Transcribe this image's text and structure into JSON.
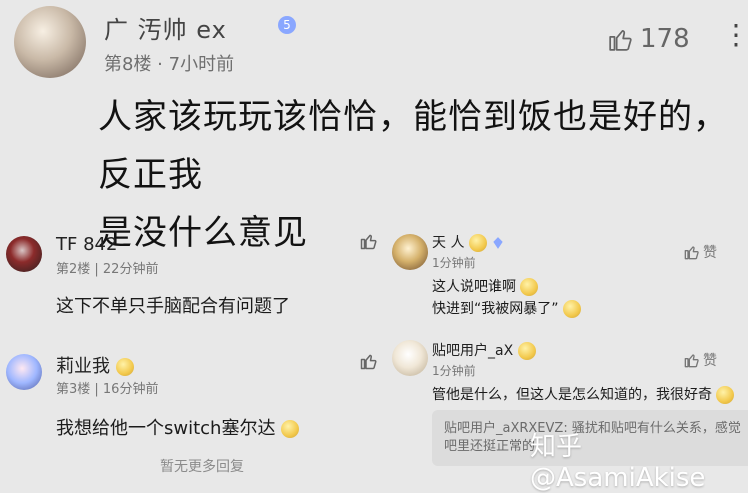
{
  "colors": {
    "background": "#e8e8e8",
    "text_primary": "#121212",
    "text_muted": "#6f6f6f",
    "badge": "#8aa7ff"
  },
  "main_comment": {
    "username": "广 汚帅 ex",
    "level_badge": "5",
    "meta": "第8楼 · 7小时前",
    "likes": "178",
    "text_line_1": "人家该玩玩该恰恰，能恰到饭也是好的，反正我",
    "text_line_2": "是没什么意见",
    "more_icon": "more-vert-icon"
  },
  "left_comments": [
    {
      "username": "TF 842",
      "meta": "第2楼 | 22分钟前",
      "text": "这下不单只手脑配合有问题了"
    },
    {
      "username": "莉业我",
      "meta": "第3楼 | 16分钟前",
      "text": "我想给他一个switch塞尔达"
    }
  ],
  "right_comments": [
    {
      "username": "天 人",
      "meta": "1分钟前",
      "line_1": "这人说吧谁啊",
      "line_2": "快进到“我被网暴了”",
      "like_label": "赞"
    },
    {
      "username": "贴吧用户_aX",
      "meta": "1分钟前",
      "line_1": "管他是什么，但这人是怎么知道的，我很好奇",
      "like_label": "赞",
      "reply_preview_line_1": "贴吧用户_aXRXEVZ: 骚扰和贴吧有什么关系，感觉",
      "reply_preview_line_2": "吧里还挺正常的"
    }
  ],
  "footer": {
    "no_more": "暂无更多回复"
  },
  "watermark": "知乎 @AsamiAkise"
}
